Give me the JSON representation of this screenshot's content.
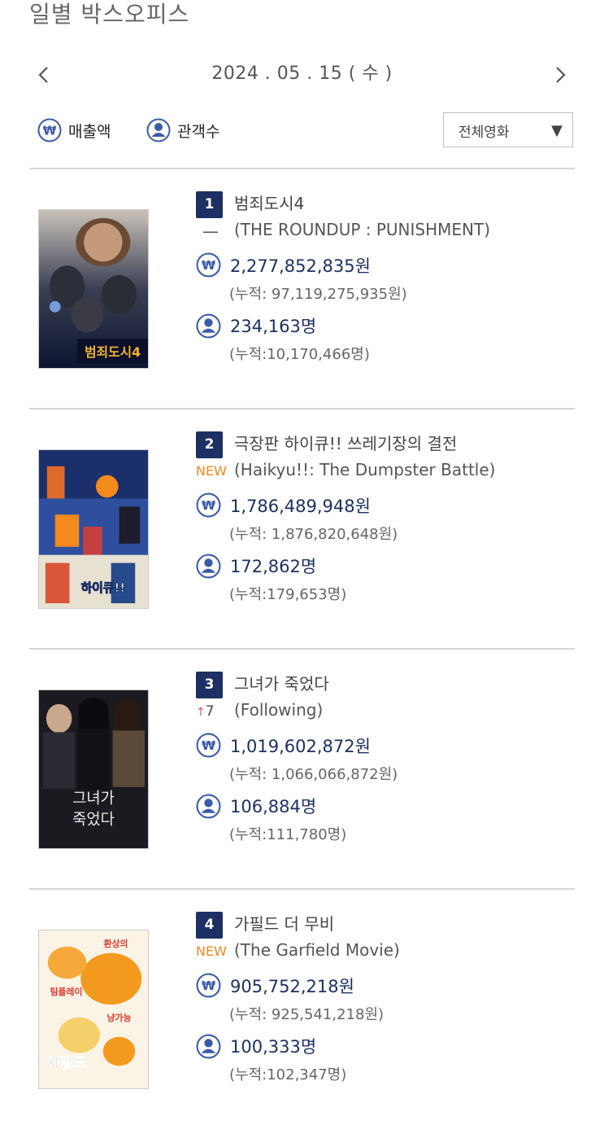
{
  "header": {
    "title": "일별 박스오피스"
  },
  "date_nav": {
    "date": "2024 . 05 . 15 ( 수 )"
  },
  "toggles": {
    "sales_label": "매출액",
    "audience_label": "관객수"
  },
  "filter": {
    "selected": "전체영화"
  },
  "colors": {
    "accent_navy": "#1d3063",
    "icon_blue": "#3a5ba8",
    "new_orange": "#f08a24",
    "up_red": "#e0524c"
  },
  "movies": [
    {
      "rank": "1",
      "title_ko": "범죄도시4",
      "change": "—",
      "title_en": "(THE ROUNDUP : PUNISHMENT)",
      "sales": "2,277,852,835원",
      "sales_cum": "(누적: 97,119,275,935원)",
      "audience": "234,163명",
      "audience_cum": "(누적:10,170,466명)",
      "poster_title": "범죄도시4"
    },
    {
      "rank": "2",
      "title_ko": "극장판 하이큐!! 쓰레기장의 결전",
      "change": "NEW",
      "title_en": "(Haikyu!!: The Dumpster Battle)",
      "sales": "1,786,489,948원",
      "sales_cum": "(누적: 1,876,820,648원)",
      "audience": "172,862명",
      "audience_cum": "(누적:179,653명)",
      "poster_title": "하이큐!!"
    },
    {
      "rank": "3",
      "title_ko": "그녀가 죽었다",
      "change": "7",
      "title_en": "(Following)",
      "sales": "1,019,602,872원",
      "sales_cum": "(누적: 1,066,066,872원)",
      "audience": "106,884명",
      "audience_cum": "(누적:111,780명)",
      "poster_title_1": "그녀가",
      "poster_title_2": "죽었다"
    },
    {
      "rank": "4",
      "title_ko": "가필드 더 무비",
      "change": "NEW",
      "title_en": "(The Garfield Movie)",
      "sales": "905,752,218원",
      "sales_cum": "(누적: 925,541,218원)",
      "audience": "100,333명",
      "audience_cum": "(누적:102,347명)",
      "poster_title": "가필드",
      "poster_tag1": "환상의",
      "poster_tag2": "팀플레이",
      "poster_tag3": "냥가능"
    }
  ]
}
